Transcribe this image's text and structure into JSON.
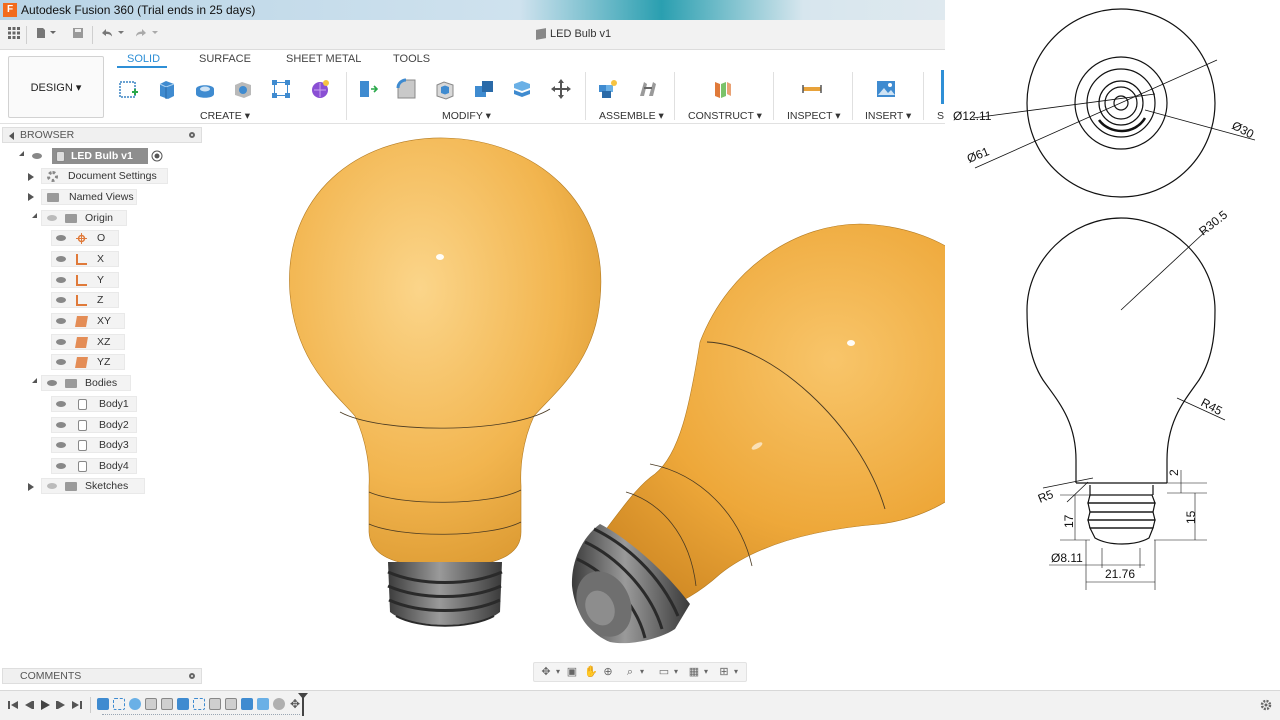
{
  "window": {
    "title": "Autodesk Fusion 360 (Trial ends in 25 days)",
    "app_logo": "F"
  },
  "document": {
    "title": "LED Bulb v1"
  },
  "workspace": {
    "label": "DESIGN ▾"
  },
  "tabs": [
    {
      "label": "SOLID",
      "active": true
    },
    {
      "label": "SURFACE",
      "active": false
    },
    {
      "label": "SHEET METAL",
      "active": false
    },
    {
      "label": "TOOLS",
      "active": false
    }
  ],
  "toolbar_groups": {
    "create": "CREATE",
    "modify": "MODIFY",
    "assemble": "ASSEMBLE",
    "construct": "CONSTRUCT",
    "inspect": "INSPECT",
    "insert": "INSERT",
    "select_cut": "S"
  },
  "browser": {
    "header": "BROWSER",
    "root": "LED Bulb v1",
    "items": {
      "document_settings": "Document Settings",
      "named_views": "Named Views",
      "origin": "Origin",
      "origin_o": "O",
      "origin_x": "X",
      "origin_y": "Y",
      "origin_z": "Z",
      "origin_xy": "XY",
      "origin_xz": "XZ",
      "origin_yz": "YZ",
      "bodies": "Bodies",
      "body1": "Body1",
      "body2": "Body2",
      "body3": "Body3",
      "body4": "Body4",
      "sketches": "Sketches"
    }
  },
  "comments": {
    "header": "COMMENTS"
  },
  "drawing": {
    "dims": {
      "d12": "Ø12.11",
      "d61": "Ø61",
      "d30": "Ø30",
      "r30_5": "R30.5",
      "r45": "R45",
      "r5": "R5",
      "h2": "2",
      "h17": "17",
      "h15": "15",
      "d8_11": "Ø8.11",
      "w21_76": "21.76"
    }
  },
  "colors": {
    "accent": "#2e8fd6",
    "bulb": "#f0b247",
    "thread": "#5e5e5e"
  }
}
